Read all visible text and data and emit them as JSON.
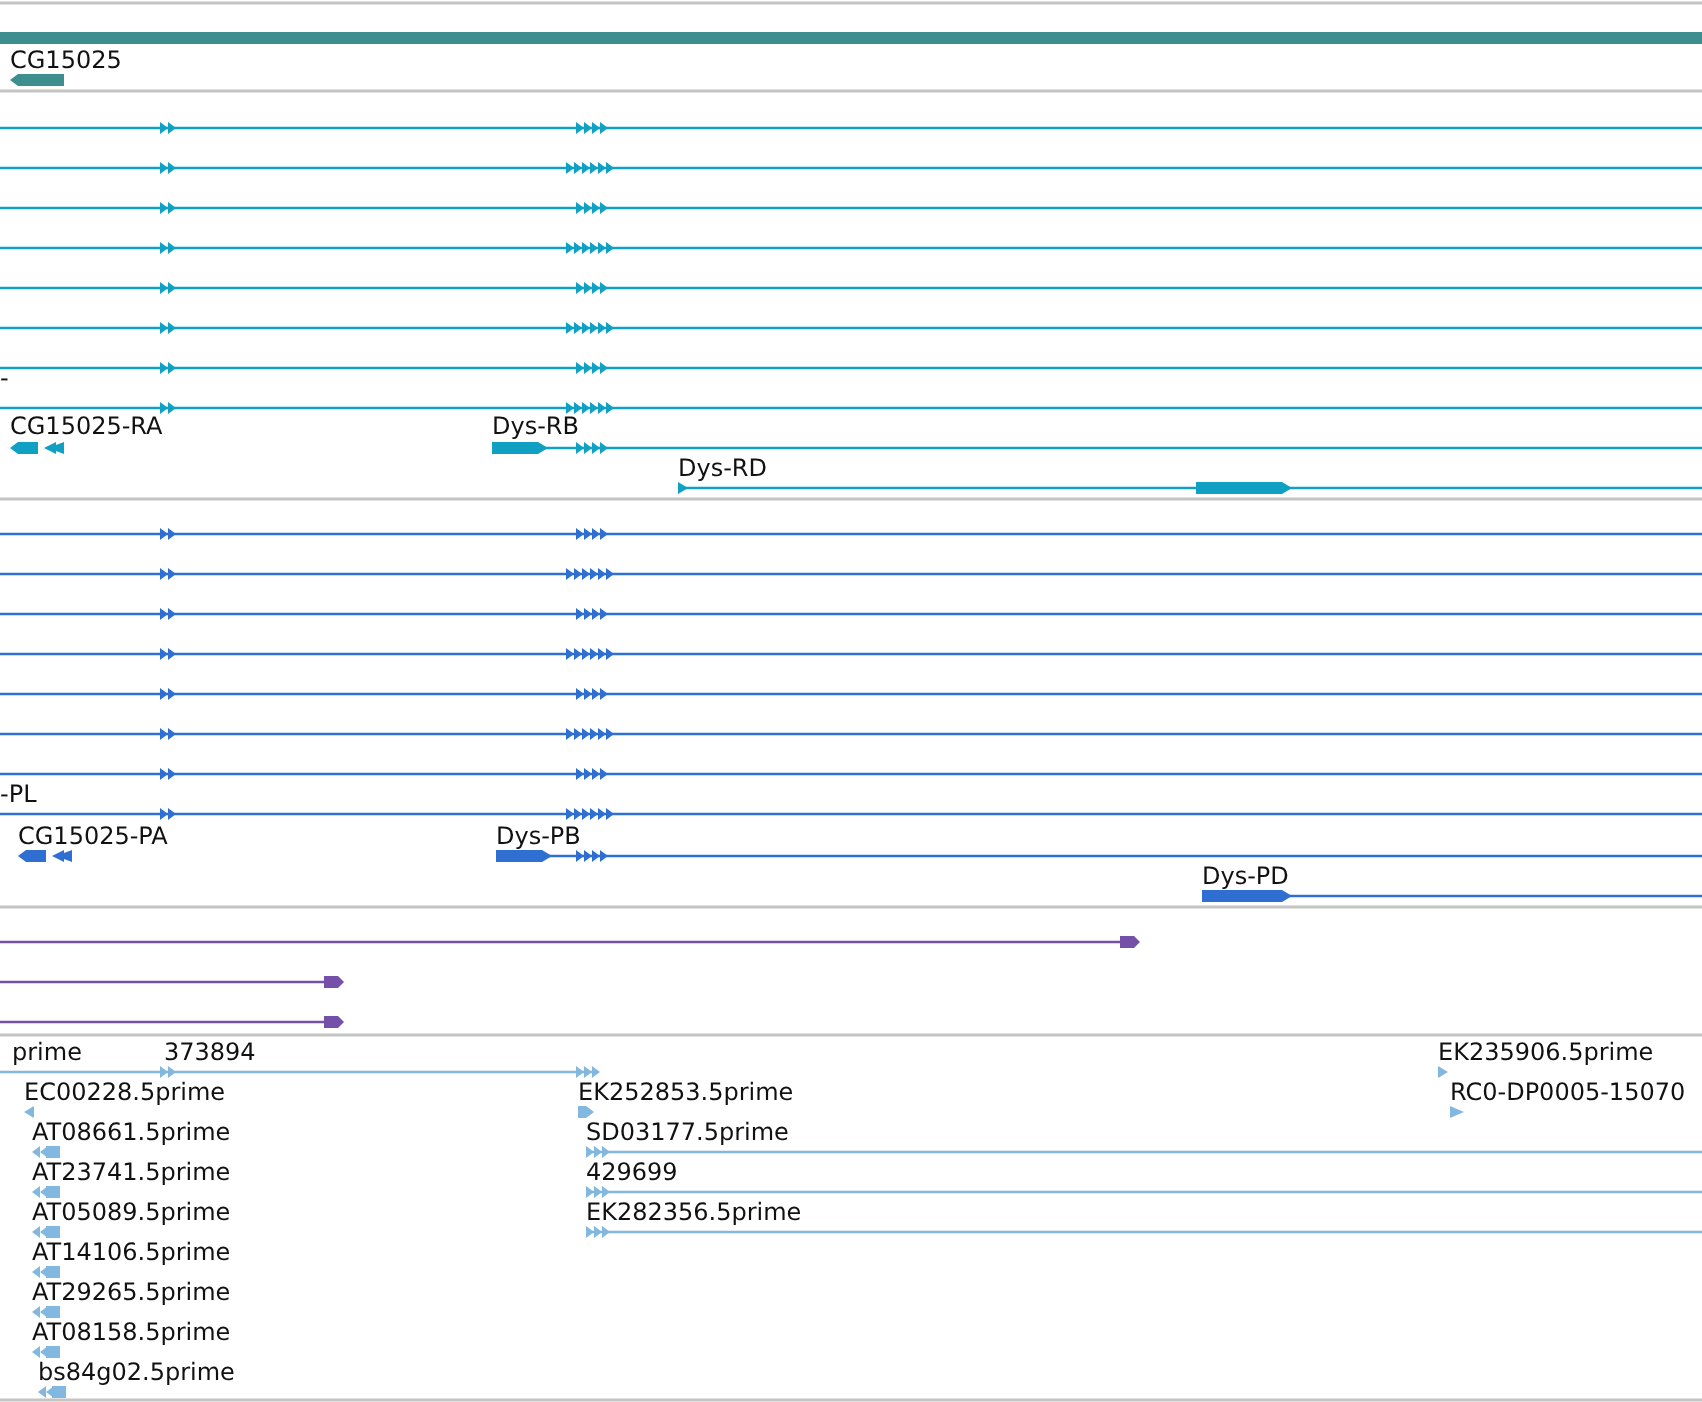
{
  "tracks": [
    {
      "kind": "gene",
      "labels": [
        "CG15025"
      ]
    },
    {
      "kind": "transcript",
      "labels": [
        "-",
        "CG15025-RA",
        "Dys-RB",
        "Dys-RD"
      ]
    },
    {
      "kind": "protein",
      "labels": [
        "-PL",
        "CG15025-PA",
        "Dys-PB",
        "Dys-PD"
      ]
    },
    {
      "kind": "match"
    },
    {
      "kind": "est",
      "labels": [
        "prime",
        "373894",
        "EC00228.5prime",
        "AT08661.5prime",
        "AT23741.5prime",
        "AT05089.5prime",
        "AT14106.5prime",
        "AT29265.5prime",
        "AT08158.5prime",
        "bs84g02.5prime",
        "EK252853.5prime",
        "SD03177.5prime",
        "429699",
        "EK282356.5prime",
        "EK235906.5prime",
        "RC0-DP0005-15070"
      ]
    }
  ]
}
